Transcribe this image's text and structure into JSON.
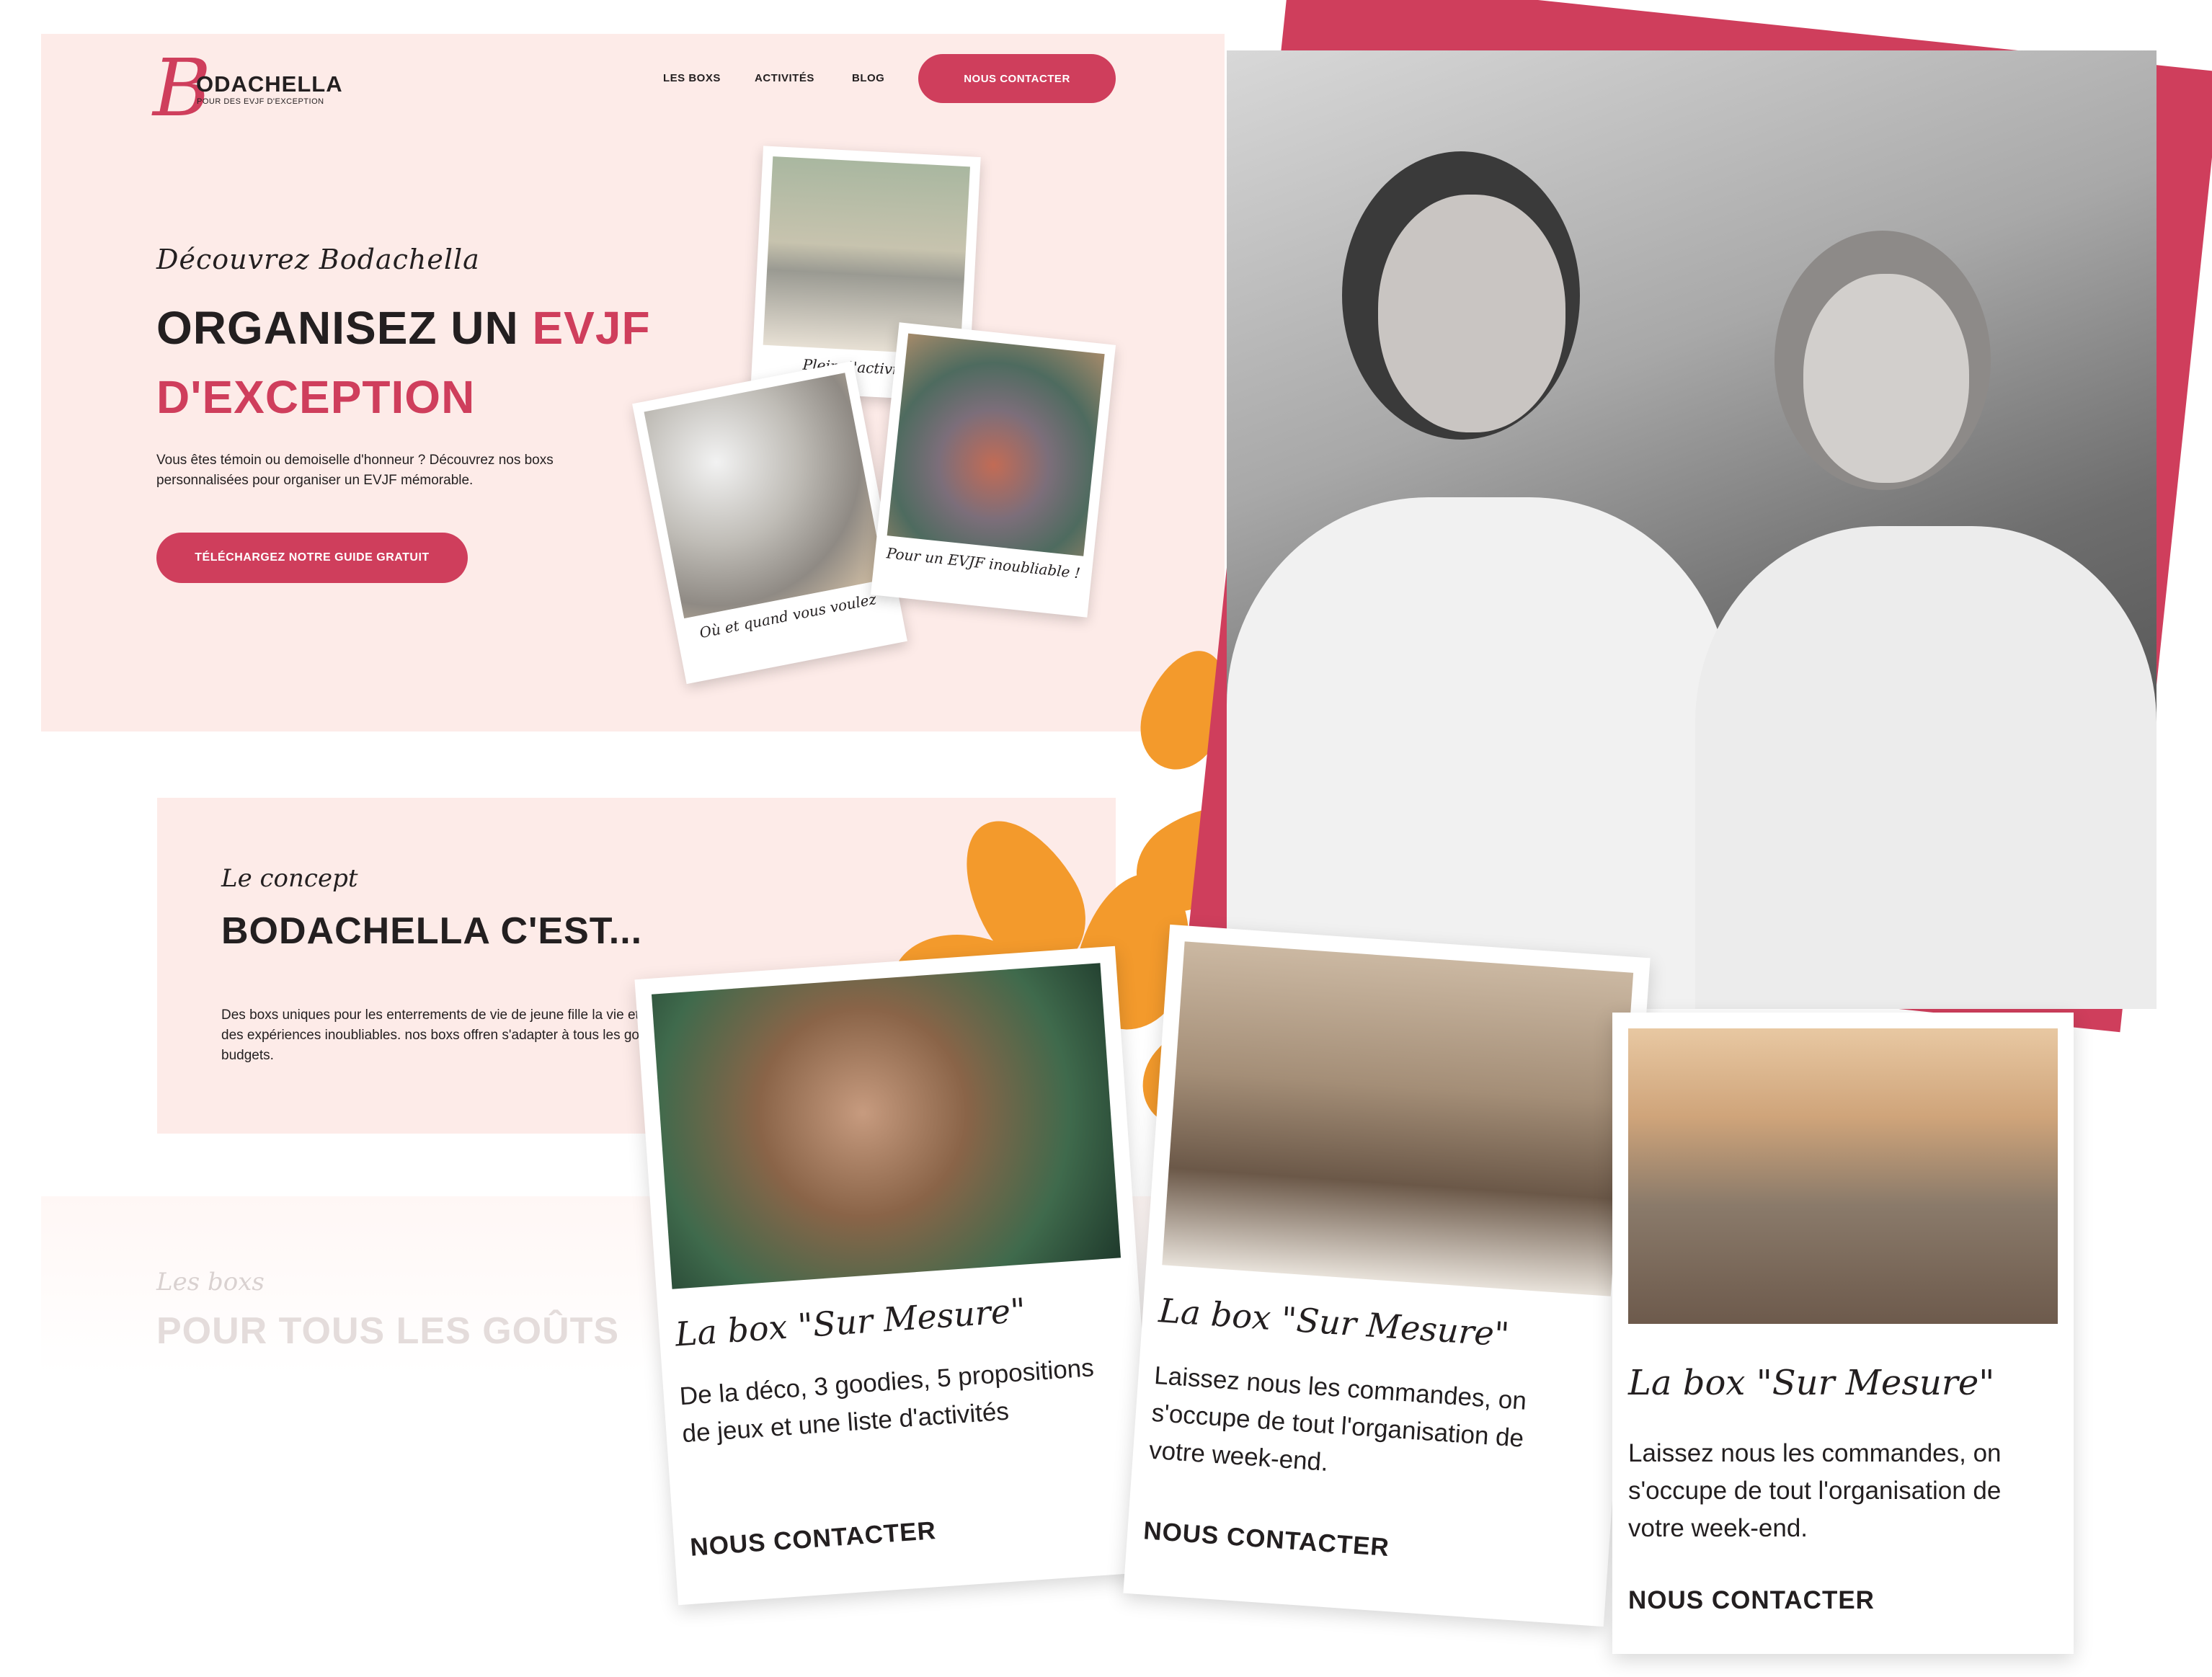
{
  "brand": {
    "logo_text": "ODACHELLA",
    "tagline": "POUR DES EVJF D'EXCEPTION"
  },
  "nav": {
    "items": [
      {
        "label": "LES BOXS"
      },
      {
        "label": "ACTIVITÉS"
      },
      {
        "label": "BLOG"
      }
    ],
    "cta_label": "NOUS CONTACTER"
  },
  "hero": {
    "kicker": "Découvrez Bodachella",
    "title_part1": "ORGANISEZ UN ",
    "title_accent1": "EVJF",
    "title_line2": "D'EXCEPTION",
    "text": "Vous êtes témoin ou demoiselle d'honneur ? Découvrez nos boxs personnalisées pour organiser un EVJF mémorable.",
    "cta_label": "TÉLÉCHARGEZ NOTRE GUIDE GRATUIT",
    "polaroids": [
      {
        "caption": "Plein d'activités"
      },
      {
        "caption": "Où et quand vous voulez"
      },
      {
        "caption": "Pour un EVJF inoubliable !"
      }
    ]
  },
  "concept": {
    "kicker": "Le concept",
    "title": "BODACHELLA C'EST...",
    "text": "Des boxs uniques pour les enterrements de vie de jeune fille la vie et créer des expériences inoubliables. nos boxs offren s'adapter à tous les goûts et budgets."
  },
  "boxes_section": {
    "kicker": "Les boxs",
    "title": "POUR TOUS LES GOÛTS"
  },
  "cards": [
    {
      "title": "La box \"Sur Mesure\"",
      "text": "De la déco, 3 goodies, 5 propositions de jeux et une liste d'activités",
      "cta": "NOUS CONTACTER"
    },
    {
      "title": "La box \"Sur Mesure\"",
      "text": "Laissez nous les commandes, on s'occupe de tout l'organisation de votre week-end.",
      "cta": "NOUS CONTACTER"
    },
    {
      "title": "La box \"Sur Mesure\"",
      "text": "Laissez nous les commandes, on s'occupe de tout l'organisation de votre week-end.",
      "cta": "NOUS CONTACTER"
    }
  ],
  "colors": {
    "accent": "#cf3e5c",
    "hero_bg": "#fdebe8",
    "flower": "#f39a2c",
    "text": "#231f20"
  }
}
